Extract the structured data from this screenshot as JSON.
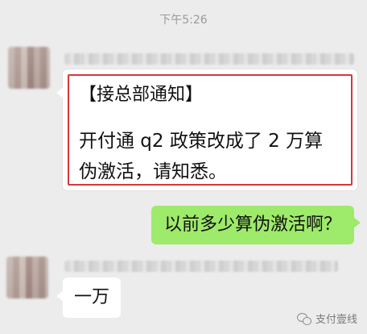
{
  "status": {
    "time": "下午5:26"
  },
  "messages": [
    {
      "side": "left",
      "title": "【接总部通知】",
      "body": "开付通 q2 政策改成了 2 万算伪激活，请知悉。"
    },
    {
      "side": "right",
      "text": "以前多少算伪激活啊？"
    },
    {
      "side": "left",
      "text": "一万"
    }
  ],
  "watermark": {
    "text": "支付壹线",
    "icon": "wechat-icon"
  },
  "colors": {
    "background": "#ececec",
    "sent_bubble": "#9eea6a",
    "highlight_border": "#d8363a"
  }
}
